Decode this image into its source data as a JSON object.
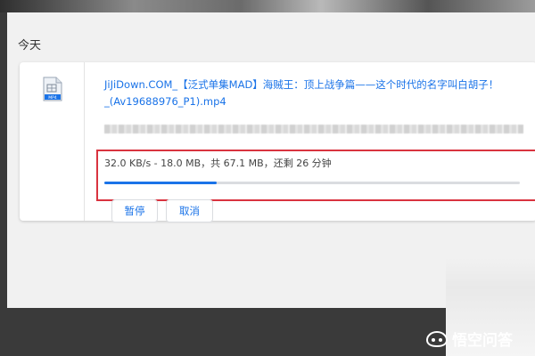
{
  "section": {
    "date_label": "今天"
  },
  "download": {
    "file_icon_label": "MP4",
    "file_name": "JiJiDown.COM_【泛式单集MAD】海贼王：顶上战争篇——这个时代的名字叫白胡子！_(Av19688976_P1).mp4",
    "status_text": "32.0 KB/s - 18.0 MB，共 67.1 MB，还剩 26 分钟",
    "progress_fraction": 0.27,
    "pause_label": "暂停",
    "cancel_label": "取消"
  },
  "watermark": {
    "text": "悟空问答"
  },
  "colors": {
    "accent": "#1a73e8",
    "highlight": "#d9333f"
  }
}
